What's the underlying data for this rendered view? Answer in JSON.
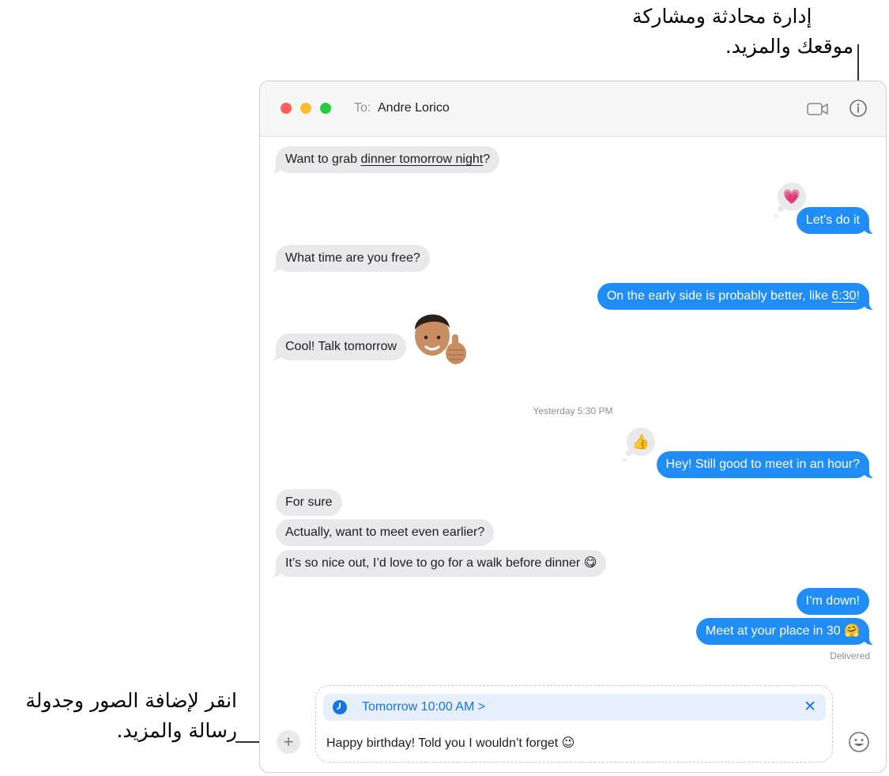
{
  "callouts": {
    "top_line1": "إدارة محادثة ومشاركة",
    "top_line2": "موقعك والمزيد.",
    "bottom_line1": "انقر لإضافة الصور وجدولة",
    "bottom_line2": "رسالة والمزيد."
  },
  "header": {
    "to_label": "To:",
    "recipient": "Andre Lorico"
  },
  "icons": {
    "video": "video-camera-icon",
    "info": "info-icon",
    "add": "plus-icon",
    "emoji": "emoji-icon",
    "clock": "clock-icon",
    "close": "close-icon"
  },
  "messages": [
    {
      "direction": "incoming",
      "text_before": "Want to grab ",
      "link": "dinner tomorrow night",
      "text_after": "?"
    },
    {
      "direction": "outgoing",
      "text": "Let’s do it",
      "tapback": "💗"
    },
    {
      "direction": "incoming",
      "text": "What time are you free?"
    },
    {
      "direction": "outgoing",
      "text_before": "On the early side is probably better, like ",
      "link": "6:30",
      "text_after": "!"
    },
    {
      "direction": "incoming",
      "text": "Cool! Talk tomorrow",
      "sticker": "memoji-thumbs-up"
    },
    {
      "direction": "outgoing",
      "text": "Hey! Still good to meet in an hour?",
      "tapback": "👍"
    },
    {
      "direction": "incoming",
      "text": "For sure"
    },
    {
      "direction": "incoming",
      "text": "Actually, want to meet even earlier?"
    },
    {
      "direction": "incoming",
      "text": "It’s so nice out, I’d love to go for a walk before dinner 😋"
    },
    {
      "direction": "outgoing",
      "text": "I’m down!"
    },
    {
      "direction": "outgoing",
      "text": "Meet at your place in 30 🤗"
    }
  ],
  "timestamp": "Yesterday 5:30 PM",
  "status": "Delivered",
  "composer": {
    "schedule_label": "Tomorrow 10:00 AM >",
    "draft": "Happy birthday! Told you I wouldn’t forget 😉",
    "close_glyph": "✕",
    "plus_glyph": "+"
  },
  "colors": {
    "outgoing_bubble": "#1f8df5",
    "incoming_bubble": "#e9e9eb",
    "accent": "#1573e6"
  }
}
